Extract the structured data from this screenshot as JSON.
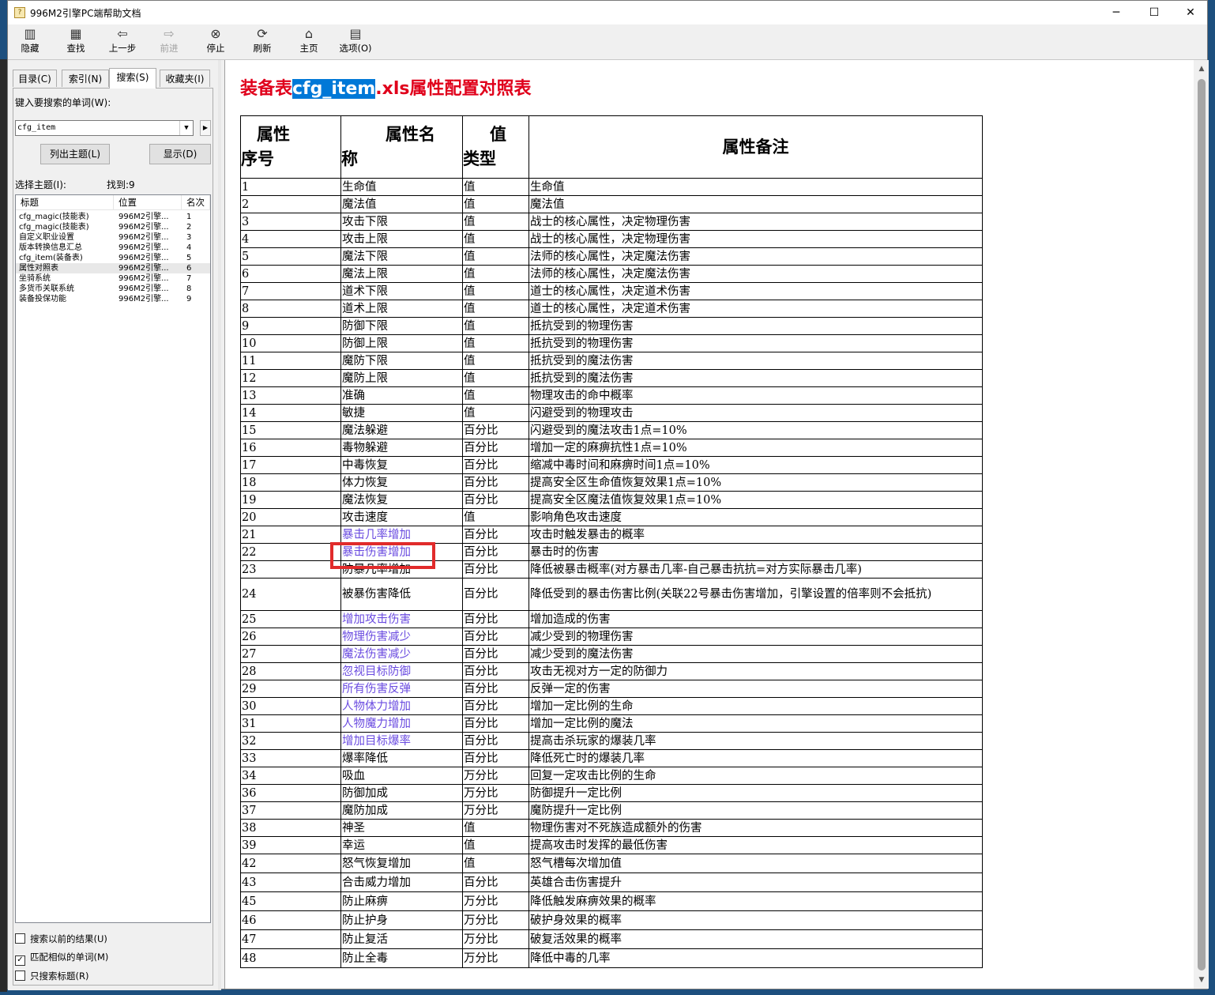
{
  "window": {
    "title": "996M2引擎PC端帮助文档",
    "minimize": "─",
    "maximize": "☐",
    "close": "✕"
  },
  "toolbar": {
    "items": [
      {
        "label": "隐藏",
        "icon": "hide-icon",
        "glyph": "▥"
      },
      {
        "label": "查找",
        "icon": "find-icon",
        "glyph": "▦"
      },
      {
        "label": "上一步",
        "icon": "back-icon",
        "glyph": "⇦"
      },
      {
        "label": "前进",
        "icon": "forward-icon",
        "glyph": "⇨"
      },
      {
        "label": "停止",
        "icon": "stop-icon",
        "glyph": "⊗"
      },
      {
        "label": "刷新",
        "icon": "refresh-icon",
        "glyph": "⟳"
      },
      {
        "label": "主页",
        "icon": "home-icon",
        "glyph": "⌂"
      },
      {
        "label": "选项(O)",
        "icon": "options-icon",
        "glyph": "▤"
      }
    ]
  },
  "left": {
    "tabs": [
      "目录(C)",
      "索引(N)",
      "搜索(S)",
      "收藏夹(I)"
    ],
    "search_label": "键入要搜索的单词(W):",
    "search_value": "cfg_item",
    "list_topics_button": "列出主题(L)",
    "display_button": "显示(D)",
    "select_topic_label": "选择主题(I):",
    "found_label": "找到:9",
    "columns": [
      "标题",
      "位置",
      "名次"
    ],
    "results": [
      {
        "title": "cfg_magic(技能表)",
        "location": "996M2引擎...",
        "rank": "1"
      },
      {
        "title": "cfg_magic(技能表)",
        "location": "996M2引擎...",
        "rank": "2"
      },
      {
        "title": "自定义职业设置",
        "location": "996M2引擎...",
        "rank": "3"
      },
      {
        "title": "版本转换信息汇总",
        "location": "996M2引擎...",
        "rank": "4"
      },
      {
        "title": "cfg_item(装备表)",
        "location": "996M2引擎...",
        "rank": "5"
      },
      {
        "title": "属性对照表",
        "location": "996M2引擎...",
        "rank": "6"
      },
      {
        "title": "坐骑系统",
        "location": "996M2引擎...",
        "rank": "7"
      },
      {
        "title": "多货币关联系统",
        "location": "996M2引擎...",
        "rank": "8"
      },
      {
        "title": "装备投保功能",
        "location": "996M2引擎...",
        "rank": "9"
      }
    ],
    "options": [
      {
        "label": "搜索以前的结果(U)",
        "checked": false
      },
      {
        "label": "匹配相似的单词(M)",
        "checked": true
      },
      {
        "label": "只搜索标题(R)",
        "checked": false
      }
    ]
  },
  "doc": {
    "title_prefix": "装备表",
    "title_highlight": "cfg_item",
    "title_suffix": ".xls属性配置对照表",
    "headers": {
      "index_a": "属性",
      "index_b": "序号",
      "name_a": "属性名",
      "name_b": "称",
      "type_a": "值",
      "type_b": "类型",
      "note": "属性备注"
    },
    "rows": [
      {
        "id": "1",
        "name": "生命值",
        "type": "值",
        "note": "生命值",
        "link": false
      },
      {
        "id": "2",
        "name": "魔法值",
        "type": "值",
        "note": "魔法值",
        "link": false
      },
      {
        "id": "3",
        "name": "攻击下限",
        "type": "值",
        "note": "战士的核心属性，决定物理伤害",
        "link": false
      },
      {
        "id": "4",
        "name": "攻击上限",
        "type": "值",
        "note": "战士的核心属性，决定物理伤害",
        "link": false
      },
      {
        "id": "5",
        "name": "魔法下限",
        "type": "值",
        "note": "法师的核心属性，决定魔法伤害",
        "link": false
      },
      {
        "id": "6",
        "name": "魔法上限",
        "type": "值",
        "note": "法师的核心属性，决定魔法伤害",
        "link": false
      },
      {
        "id": "7",
        "name": "道术下限",
        "type": "值",
        "note": "道士的核心属性，决定道术伤害",
        "link": false
      },
      {
        "id": "8",
        "name": "道术上限",
        "type": "值",
        "note": "道士的核心属性，决定道术伤害",
        "link": false
      },
      {
        "id": "9",
        "name": "防御下限",
        "type": "值",
        "note": "抵抗受到的物理伤害",
        "link": false
      },
      {
        "id": "10",
        "name": "防御上限",
        "type": "值",
        "note": "抵抗受到的物理伤害",
        "link": false
      },
      {
        "id": "11",
        "name": "魔防下限",
        "type": "值",
        "note": "抵抗受到的魔法伤害",
        "link": false
      },
      {
        "id": "12",
        "name": "魔防上限",
        "type": "值",
        "note": "抵抗受到的魔法伤害",
        "link": false
      },
      {
        "id": "13",
        "name": "准确",
        "type": "值",
        "note": "物理攻击的命中概率",
        "link": false
      },
      {
        "id": "14",
        "name": "敏捷",
        "type": "值",
        "note": "闪避受到的物理攻击",
        "link": false
      },
      {
        "id": "15",
        "name": "魔法躲避",
        "type": "百分比",
        "note": "闪避受到的魔法攻击1点=10%",
        "link": false
      },
      {
        "id": "16",
        "name": "毒物躲避",
        "type": "百分比",
        "note": "增加一定的麻痹抗性1点=10%",
        "link": false
      },
      {
        "id": "17",
        "name": "中毒恢复",
        "type": "百分比",
        "note": "缩减中毒时间和麻痹时间1点=10%",
        "link": false
      },
      {
        "id": "18",
        "name": "体力恢复",
        "type": "百分比",
        "note": "提高安全区生命值恢复效果1点=10%",
        "link": false
      },
      {
        "id": "19",
        "name": "魔法恢复",
        "type": "百分比",
        "note": "提高安全区魔法值恢复效果1点=10%",
        "link": false
      },
      {
        "id": "20",
        "name": "攻击速度",
        "type": "值",
        "note": "影响角色攻击速度",
        "link": false
      },
      {
        "id": "21",
        "name": "暴击几率增加",
        "type": "百分比",
        "note": "攻击时触发暴击的概率",
        "link": true
      },
      {
        "id": "22",
        "name": "暴击伤害增加",
        "type": "百分比",
        "note": "暴击时的伤害",
        "link": true
      },
      {
        "id": "23",
        "name": "防暴几率增加",
        "type": "百分比",
        "note": "降低被暴击概率(对方暴击几率-自己暴击抗抗=对方实际暴击几率)",
        "link": false
      },
      {
        "id": "24",
        "name": "被暴伤害降低",
        "type": "百分比",
        "note": "降低受到的暴击伤害比例(关联22号暴击伤害增加，引擎设置的倍率则不会抵抗)",
        "link": false
      },
      {
        "id": "25",
        "name": "增加攻击伤害",
        "type": "百分比",
        "note": "增加造成的伤害",
        "link": true
      },
      {
        "id": "26",
        "name": "物理伤害减少",
        "type": "百分比",
        "note": "减少受到的物理伤害",
        "link": true
      },
      {
        "id": "27",
        "name": "魔法伤害减少",
        "type": "百分比",
        "note": "减少受到的魔法伤害",
        "link": true
      },
      {
        "id": "28",
        "name": "忽视目标防御",
        "type": "百分比",
        "note": "攻击无视对方一定的防御力",
        "link": true
      },
      {
        "id": "29",
        "name": "所有伤害反弹",
        "type": "百分比",
        "note": "反弹一定的伤害",
        "link": true
      },
      {
        "id": "30",
        "name": "人物体力增加",
        "type": "百分比",
        "note": "增加一定比例的生命",
        "link": true
      },
      {
        "id": "31",
        "name": "人物魔力增加",
        "type": "百分比",
        "note": "增加一定比例的魔法",
        "link": true
      },
      {
        "id": "32",
        "name": "增加目标爆率",
        "type": "百分比",
        "note": "提高击杀玩家的爆装几率",
        "link": true
      },
      {
        "id": "33",
        "name": "爆率降低",
        "type": "百分比",
        "note": "降低死亡时的爆装几率",
        "link": false
      },
      {
        "id": "34",
        "name": "吸血",
        "type": "万分比",
        "note": "回复一定攻击比例的生命",
        "link": false
      },
      {
        "id": "36",
        "name": "防御加成",
        "type": "万分比",
        "note": "防御提升一定比例",
        "link": false
      },
      {
        "id": "37",
        "name": "魔防加成",
        "type": "万分比",
        "note": "魔防提升一定比例",
        "link": false
      },
      {
        "id": "38",
        "name": "神圣",
        "type": "值",
        "note": "物理伤害对不死族造成额外的伤害",
        "link": false
      },
      {
        "id": "39",
        "name": "幸运",
        "type": "值",
        "note": "提高攻击时发挥的最低伤害",
        "link": false
      },
      {
        "id": "42",
        "name": "怒气恢复增加",
        "type": "值",
        "note": "怒气槽每次增加值",
        "link": false
      },
      {
        "id": "43",
        "name": "合击威力增加",
        "type": "百分比",
        "note": "英雄合击伤害提升",
        "link": false
      },
      {
        "id": "45",
        "name": "防止麻痹",
        "type": "万分比",
        "note": "降低触发麻痹效果的概率",
        "link": false
      },
      {
        "id": "46",
        "name": "防止护身",
        "type": "万分比",
        "note": "破护身效果的概率",
        "link": false
      },
      {
        "id": "47",
        "name": "防止复活",
        "type": "万分比",
        "note": "破复活效果的概率",
        "link": false
      },
      {
        "id": "48",
        "name": "防止全毒",
        "type": "万分比",
        "note": "降低中毒的几率",
        "link": false
      }
    ]
  }
}
